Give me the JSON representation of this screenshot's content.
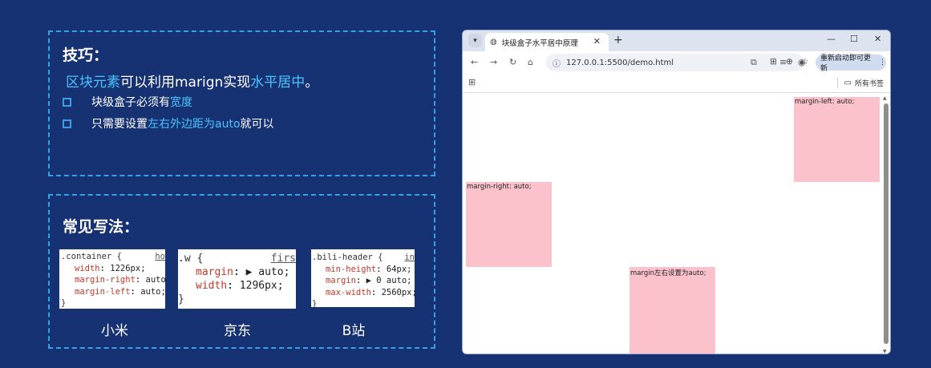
{
  "slide": {
    "tips": {
      "title": "技巧：",
      "main_highlight_1": "区块元素",
      "main_text_1": "可以利用marign实现",
      "main_highlight_2": "水平居中",
      "main_text_2": "。",
      "bullets": [
        {
          "text": "块级盒子必须有",
          "highlight": "宽度",
          "suffix": ""
        },
        {
          "text": "只需要设置",
          "highlight": "左右外边距为auto",
          "suffix": "就可以"
        }
      ]
    },
    "common": {
      "title": "常见写法：",
      "cards": [
        {
          "brand": "小米",
          "selector": ".container {",
          "link": "ho",
          "lines": [
            {
              "prop": "width",
              "value": "1226px;"
            },
            {
              "prop": "margin-right",
              "value": "auto;"
            },
            {
              "prop": "margin-left",
              "value": "auto;"
            }
          ],
          "close": "}"
        },
        {
          "brand": "京东",
          "selector": ".w {",
          "link": "firs",
          "lines": [
            {
              "prop": "margin",
              "value": "▶ auto;"
            },
            {
              "prop": "width",
              "value": "1296px;"
            }
          ],
          "close": "}"
        },
        {
          "brand": "B站",
          "selector": ".bili-header {",
          "link": "in",
          "lines": [
            {
              "prop": "min-height",
              "value": "64px;"
            },
            {
              "prop": "margin",
              "value": "▶ 0 auto;"
            },
            {
              "prop": "max-width",
              "value": "2560px;"
            }
          ],
          "close": "}"
        }
      ]
    }
  },
  "browser": {
    "tab_title": "块级盒子水平居中原理",
    "url": "127.0.0.1:5500/demo.html",
    "update_button": "重新启动即可更新",
    "bookmarks_all": "所有书签",
    "boxes": [
      {
        "label": "margin-left: auto;"
      },
      {
        "label": "margin-right: auto;"
      },
      {
        "label": "margin左右设置为auto;"
      }
    ]
  },
  "icons": {
    "tab_menu": "chevron-down-icon",
    "tab_favicon": "globe-icon",
    "tab_close": "close-icon",
    "new_tab": "plus-icon",
    "minimize": "minimize-icon",
    "maximize": "maximize-icon",
    "close_window": "close-window-icon",
    "back": "back-arrow-icon",
    "forward": "forward-arrow-icon",
    "reload": "reload-icon",
    "home": "home-icon",
    "site_info": "info-icon",
    "translate": "translate-icon",
    "zoom": "zoom-icon",
    "bookmark_star": "star-icon",
    "extensions": "puzzle-icon",
    "media": "media-icon",
    "profile": "profile-icon",
    "more": "more-vertical-icon",
    "apps": "apps-grid-icon",
    "folder": "folder-icon"
  },
  "colors": {
    "background": "#173272",
    "dashed_border": "#3aa0e6",
    "highlight": "#4cc3ff",
    "demo_box": "#fbc2cb"
  }
}
